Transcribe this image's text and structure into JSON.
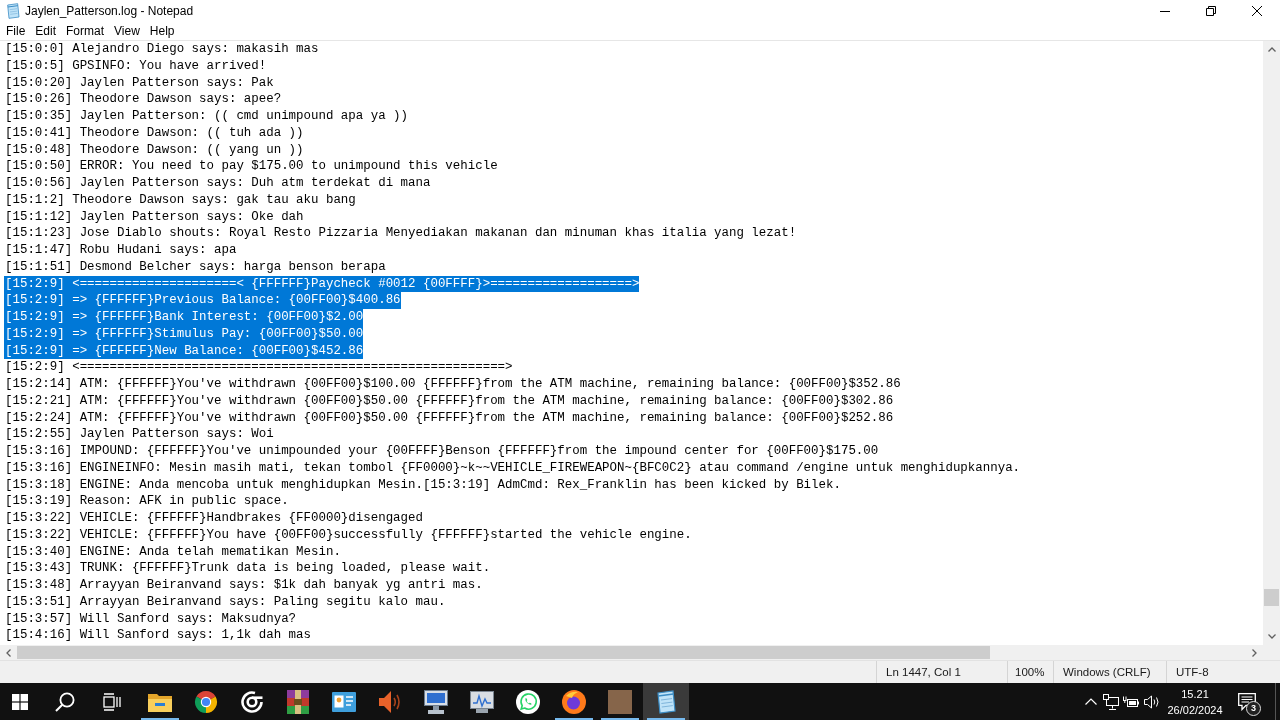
{
  "window": {
    "title": "Jaylen_Patterson.log - Notepad"
  },
  "menu": [
    "File",
    "Edit",
    "Format",
    "View",
    "Help"
  ],
  "editor": {
    "lines": [
      {
        "text": "[15:0:0] Alejandro Diego says: makasih mas",
        "selected": false
      },
      {
        "text": "[15:0:5] GPSINFO: You have arrived!",
        "selected": false
      },
      {
        "text": "[15:0:20] Jaylen Patterson says: Pak",
        "selected": false
      },
      {
        "text": "[15:0:26] Theodore Dawson says: apee?",
        "selected": false
      },
      {
        "text": "[15:0:35] Jaylen Patterson: (( cmd unimpound apa ya ))",
        "selected": false
      },
      {
        "text": "[15:0:41] Theodore Dawson: (( tuh ada ))",
        "selected": false
      },
      {
        "text": "[15:0:48] Theodore Dawson: (( yang un ))",
        "selected": false
      },
      {
        "text": "[15:0:50] ERROR: You need to pay $175.00 to unimpound this vehicle",
        "selected": false
      },
      {
        "text": "[15:0:56] Jaylen Patterson says: Duh atm terdekat di mana",
        "selected": false
      },
      {
        "text": "[15:1:2] Theodore Dawson says: gak tau aku bang",
        "selected": false
      },
      {
        "text": "[15:1:12] Jaylen Patterson says: Oke dah",
        "selected": false
      },
      {
        "text": "[15:1:23] Jose Diablo shouts: Royal Resto Pizzaria Menyediakan makanan dan minuman khas italia yang lezat!",
        "selected": false
      },
      {
        "text": "[15:1:47] Robu Hudani says: apa",
        "selected": false
      },
      {
        "text": "[15:1:51] Desmond Belcher says: harga benson berapa",
        "selected": false
      },
      {
        "text": "[15:2:9] <=====================< {FFFFFF}Paycheck #0012 {00FFFF}>===================>",
        "selected": true
      },
      {
        "text": "[15:2:9] => {FFFFFF}Previous Balance: {00FF00}$400.86",
        "selected": true
      },
      {
        "text": "[15:2:9] => {FFFFFF}Bank Interest: {00FF00}$2.00",
        "selected": true
      },
      {
        "text": "[15:2:9] => {FFFFFF}Stimulus Pay: {00FF00}$50.00",
        "selected": true
      },
      {
        "text": "[15:2:9] => {FFFFFF}New Balance: {00FF00}$452.86",
        "selected": true
      },
      {
        "text": "[15:2:9] <=========================================================>",
        "selected": false
      },
      {
        "text": "[15:2:14] ATM: {FFFFFF}You've withdrawn {00FF00}$100.00 {FFFFFF}from the ATM machine, remaining balance: {00FF00}$352.86",
        "selected": false
      },
      {
        "text": "[15:2:21] ATM: {FFFFFF}You've withdrawn {00FF00}$50.00 {FFFFFF}from the ATM machine, remaining balance: {00FF00}$302.86",
        "selected": false
      },
      {
        "text": "[15:2:24] ATM: {FFFFFF}You've withdrawn {00FF00}$50.00 {FFFFFF}from the ATM machine, remaining balance: {00FF00}$252.86",
        "selected": false
      },
      {
        "text": "[15:2:55] Jaylen Patterson says: Woi",
        "selected": false
      },
      {
        "text": "[15:3:16] IMPOUND: {FFFFFF}You've unimpounded your {00FFFF}Benson {FFFFFF}from the impound center for {00FF00}$175.00",
        "selected": false
      },
      {
        "text": "[15:3:16] ENGINEINFO: Mesin masih mati, tekan tombol {FF0000}~k~~VEHICLE_FIREWEAPON~{BFC0C2} atau command /engine untuk menghidupkannya.",
        "selected": false
      },
      {
        "text": "[15:3:18] ENGINE: Anda mencoba untuk menghidupkan Mesin.[15:3:19] AdmCmd: Rex_Franklin has been kicked by Bilek.",
        "selected": false
      },
      {
        "text": "[15:3:19] Reason: AFK in public space.",
        "selected": false
      },
      {
        "text": "[15:3:22] VEHICLE: {FFFFFF}Handbrakes {FF0000}disengaged",
        "selected": false
      },
      {
        "text": "[15:3:22] VEHICLE: {FFFFFF}You have {00FF00}successfully {FFFFFF}started the vehicle engine.",
        "selected": false
      },
      {
        "text": "[15:3:40] ENGINE: Anda telah mematikan Mesin.",
        "selected": false
      },
      {
        "text": "[15:3:43] TRUNK: {FFFFFF}Trunk data is being loaded, please wait.",
        "selected": false
      },
      {
        "text": "[15:3:48] Arrayyan Beiranvand says: $1k dah banyak yg antri mas.",
        "selected": false
      },
      {
        "text": "[15:3:51] Arrayyan Beiranvand says: Paling segitu kalo mau.",
        "selected": false
      },
      {
        "text": "[15:3:57] Will Sanford says: Maksudnya?",
        "selected": false
      },
      {
        "text": "[15:4:16] Will Sanford says: 1,1k dah mas",
        "selected": false
      }
    ]
  },
  "status_bar": {
    "position": "Ln 1447, Col 1",
    "zoom": "100%",
    "line_ending": "Windows (CRLF)",
    "encoding": "UTF-8"
  },
  "taskbar": {
    "apps": [
      {
        "kind": "folder",
        "running": true,
        "active": false
      },
      {
        "kind": "browser",
        "running": false,
        "active": false
      },
      {
        "kind": "ring",
        "running": false,
        "active": false
      },
      {
        "kind": "archive",
        "running": false,
        "active": false
      },
      {
        "kind": "card",
        "running": false,
        "active": false
      },
      {
        "kind": "speaker",
        "running": false,
        "active": false
      },
      {
        "kind": "monitor",
        "running": false,
        "active": false
      },
      {
        "kind": "chart",
        "running": false,
        "active": false
      },
      {
        "kind": "chat",
        "running": false,
        "active": false
      },
      {
        "kind": "globe",
        "running": true,
        "active": false
      },
      {
        "kind": "photo",
        "running": true,
        "active": false
      },
      {
        "kind": "notepad",
        "running": true,
        "active": true
      }
    ],
    "clock": {
      "time": "15.21",
      "date": "26/02/2024"
    },
    "notifications": "3"
  }
}
